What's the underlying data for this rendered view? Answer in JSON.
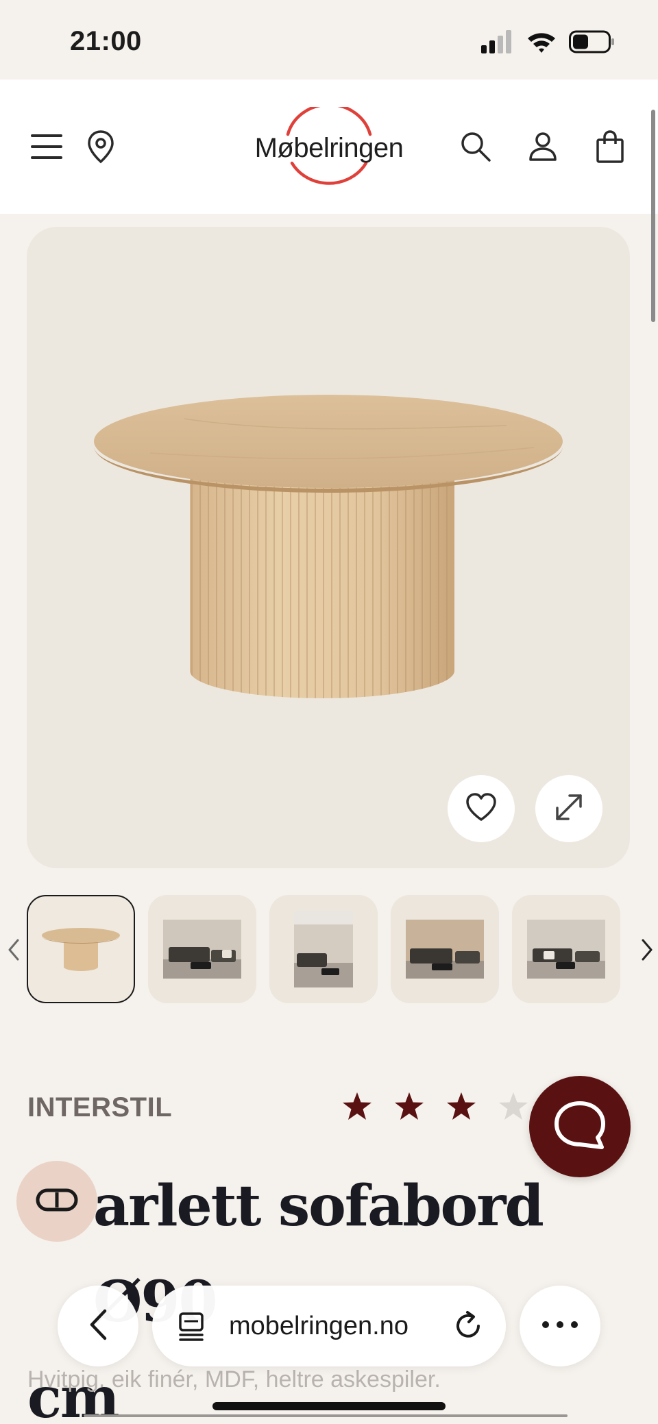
{
  "status_bar": {
    "time": "21:00",
    "icons": [
      "cellular-signal-icon",
      "wifi-icon",
      "battery-icon"
    ]
  },
  "header": {
    "logo_text": "Møbelringen",
    "left_icons": [
      "menu-icon",
      "location-pin-icon"
    ],
    "right_icons": [
      "search-icon",
      "account-icon",
      "shopping-bag-icon"
    ],
    "logo_ring_color": "#e0403a"
  },
  "gallery": {
    "main_image": "round-fluted-oak-coffee-table",
    "actions": [
      "heart-icon",
      "expand-icon"
    ],
    "thumbnails": [
      {
        "name": "table-product",
        "active": true
      },
      {
        "name": "living-room-scene-1",
        "active": false
      },
      {
        "name": "living-room-scene-2",
        "active": false
      },
      {
        "name": "living-room-scene-3",
        "active": false
      },
      {
        "name": "living-room-scene-4",
        "active": false
      }
    ],
    "arrows": [
      "chevron-left-icon",
      "chevron-right-icon"
    ]
  },
  "product": {
    "brand": "INTERSTIL",
    "rating": {
      "filled": 3,
      "total": 5,
      "star_color": "#5a1111"
    },
    "title_line1": "arlett sofabord Ø90",
    "title_line2": "cm",
    "description": "Hvitpig. eik finér, MDF, heltre askespiler."
  },
  "floating": {
    "chat_color": "#5a1111",
    "loop_color": "#ead2c6"
  },
  "browser": {
    "url": "mobelringen.no",
    "icons": [
      "back-arrow-icon",
      "tab-overview-icon",
      "reload-icon",
      "more-icon"
    ]
  }
}
